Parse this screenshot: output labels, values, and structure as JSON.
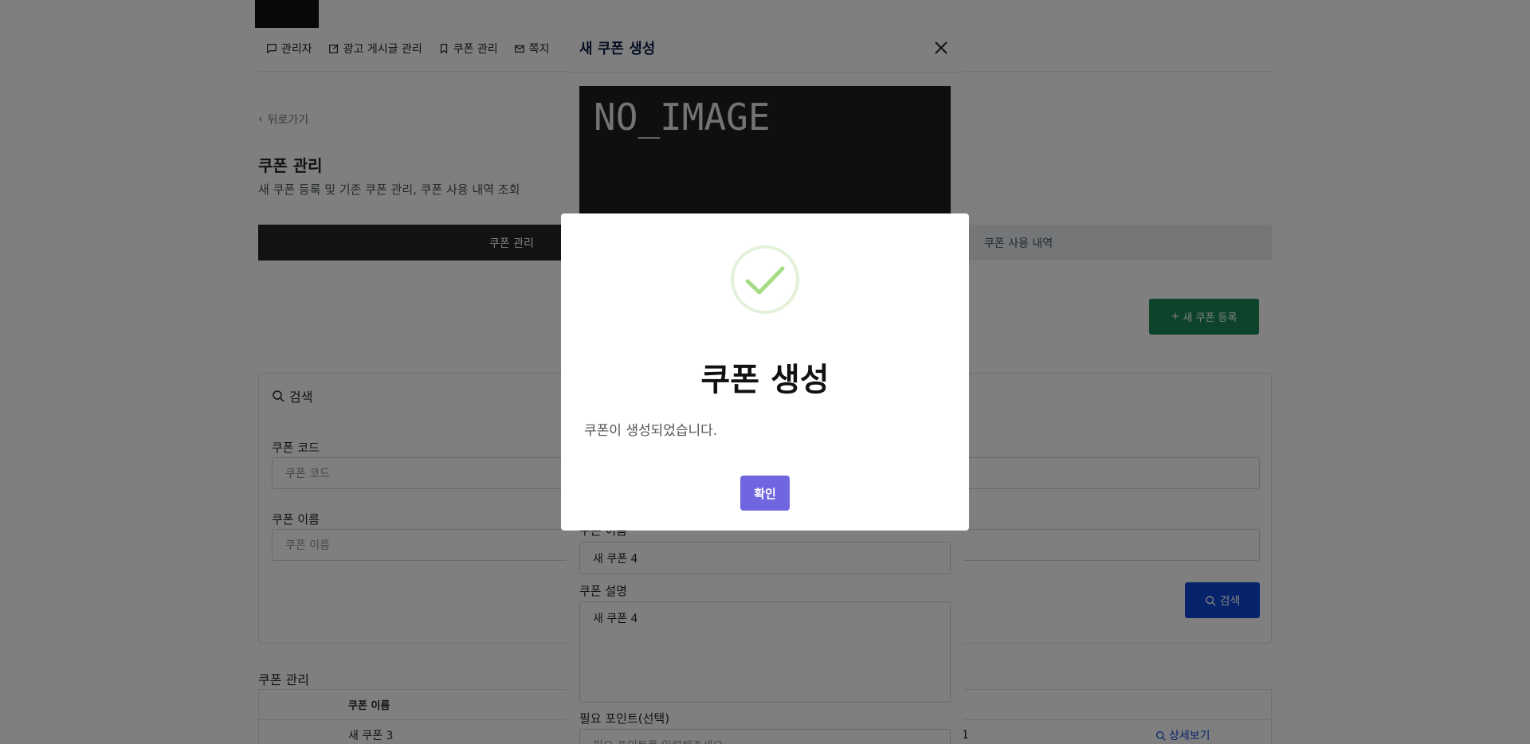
{
  "nav": {
    "items": [
      {
        "label": "관리자",
        "icon": "chat-icon"
      },
      {
        "label": "광고 게시글 관리",
        "icon": "pencil-square-icon"
      },
      {
        "label": "쿠폰 관리",
        "icon": "bookmark-icon"
      },
      {
        "label": "쪽지",
        "icon": "envelope-icon"
      }
    ]
  },
  "page": {
    "back_label": "뒤로가기",
    "title": "쿠폰 관리",
    "subtitle": "새 쿠폰 등록 및 기존 쿠폰 관리, 쿠폰 사용 내역 조회",
    "tabs": [
      {
        "label": "쿠폰 관리",
        "active": true
      },
      {
        "label": "쿠폰 사용 내역",
        "active": false
      }
    ],
    "new_coupon_label": "새 쿠폰 등록"
  },
  "search": {
    "heading": "검색",
    "code_label": "쿠폰 코드",
    "code_placeholder": "쿠폰 코드",
    "name_label": "쿠폰 이름",
    "name_placeholder": "쿠폰 이름",
    "button_label": "검색"
  },
  "list": {
    "title": "쿠폰 관리",
    "headers": [
      "쿠폰 이름"
    ],
    "rows": [
      {
        "name": "새 쿠폰 3",
        "num": "1",
        "detail": "상세보기"
      }
    ]
  },
  "create_modal": {
    "title": "새 쿠폰 생성",
    "image_placeholder": "NO_IMAGE",
    "name_label": "쿠폰 이름",
    "name_value": "새 쿠폰 4",
    "desc_label": "쿠폰 설명",
    "desc_value": "새 쿠폰 4",
    "points_label": "필요 포인트(선택)",
    "points_placeholder": "필요 포인트를 입력해주세요"
  },
  "alert": {
    "title": "쿠폰 생성",
    "text": "쿠폰이 생성되었습니다.",
    "confirm_label": "확인",
    "accent": "#7066e0",
    "success_color": "#a5dc86"
  }
}
